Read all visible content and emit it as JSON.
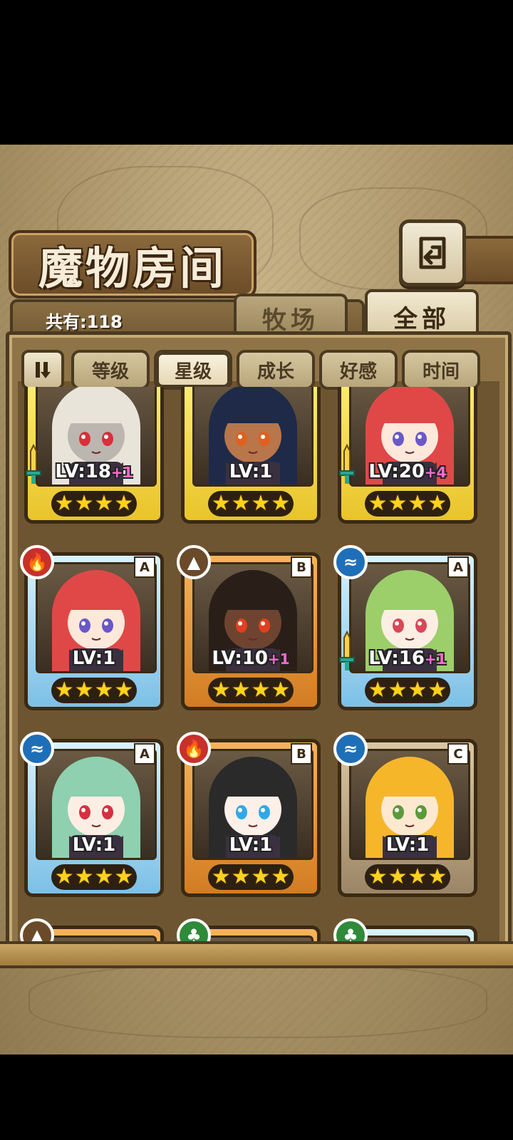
{
  "title": "魔物房间",
  "count_label": "共有:118",
  "tabs": {
    "ranch": "牧场",
    "all": "全部",
    "active": "all"
  },
  "sort": {
    "toggle_icon": "sort-toggle-icon",
    "buttons": [
      "等级",
      "星级",
      "成长",
      "好感",
      "时间"
    ],
    "active": "星级"
  },
  "colors": {
    "gold": "#e9c42a",
    "blue": "#7cc0e6",
    "orange": "#d27c22",
    "tan": "#9b8566",
    "fire": "#c8302a",
    "water": "#1e6fb8",
    "earth": "#6b4a2a",
    "nature": "#2f8a3a"
  },
  "cards": [
    {
      "frame": "gold",
      "element": "",
      "grade": "",
      "level": "LV:18",
      "bonus": "+1",
      "stars": "★★★★",
      "weapon": true,
      "hair": "#e9e4da",
      "skin": "#bcb6b0",
      "eye": "#d8303a"
    },
    {
      "frame": "gold",
      "element": "",
      "grade": "",
      "level": "LV:1",
      "bonus": "",
      "stars": "★★★★",
      "weapon": false,
      "hair": "#1f2a48",
      "skin": "#b8764a",
      "eye": "#e06020"
    },
    {
      "frame": "gold",
      "element": "",
      "grade": "",
      "level": "LV:20",
      "bonus": "+4",
      "stars": "★★★★",
      "weapon": true,
      "hair": "#e04848",
      "skin": "#fde8da",
      "eye": "#6a58c8"
    },
    {
      "frame": "blue",
      "element": "fire",
      "grade": "A",
      "level": "LV:1",
      "bonus": "",
      "stars": "★★★★",
      "weapon": false,
      "hair": "#e04848",
      "skin": "#fde8da",
      "eye": "#6a58c8"
    },
    {
      "frame": "orange",
      "element": "earth",
      "grade": "B",
      "level": "LV:10",
      "bonus": "+1",
      "stars": "★★★★",
      "weapon": false,
      "hair": "#2a1e18",
      "skin": "#6e4430",
      "eye": "#e04020"
    },
    {
      "frame": "blue",
      "element": "water",
      "grade": "A",
      "level": "LV:16",
      "bonus": "+1",
      "stars": "★★★★",
      "weapon": true,
      "hair": "#9ccf6a",
      "skin": "#fdeee4",
      "eye": "#d84858"
    },
    {
      "frame": "blue",
      "element": "water",
      "grade": "A",
      "level": "LV:1",
      "bonus": "",
      "stars": "★★★★",
      "weapon": false,
      "hair": "#8fd0b0",
      "skin": "#fdeee4",
      "eye": "#d83040"
    },
    {
      "frame": "orange",
      "element": "fire",
      "grade": "B",
      "level": "LV:1",
      "bonus": "",
      "stars": "★★★★",
      "weapon": false,
      "hair": "#2a2a2a",
      "skin": "#fdf0e8",
      "eye": "#30a8e8"
    },
    {
      "frame": "tan",
      "element": "water",
      "grade": "C",
      "level": "LV:1",
      "bonus": "",
      "stars": "★★★★",
      "weapon": false,
      "hair": "#f5b62a",
      "skin": "#fde8d0",
      "eye": "#5a9a3a"
    },
    {
      "frame": "orange",
      "element": "earth",
      "grade": "",
      "level": "",
      "bonus": "",
      "stars": "",
      "weapon": false,
      "hair": "#c0582a",
      "skin": "#f3d8c0",
      "eye": "#c03030"
    },
    {
      "frame": "orange",
      "element": "nature",
      "grade": "",
      "level": "",
      "bonus": "",
      "stars": "",
      "weapon": false,
      "hair": "#5a3a2a",
      "skin": "#f3d8c0",
      "eye": "#c03030"
    },
    {
      "frame": "blue",
      "element": "nature",
      "grade": "",
      "level": "",
      "bonus": "",
      "stars": "",
      "weapon": false,
      "hair": "#d0a0d0",
      "skin": "#f3d8c0",
      "eye": "#c03030"
    }
  ]
}
